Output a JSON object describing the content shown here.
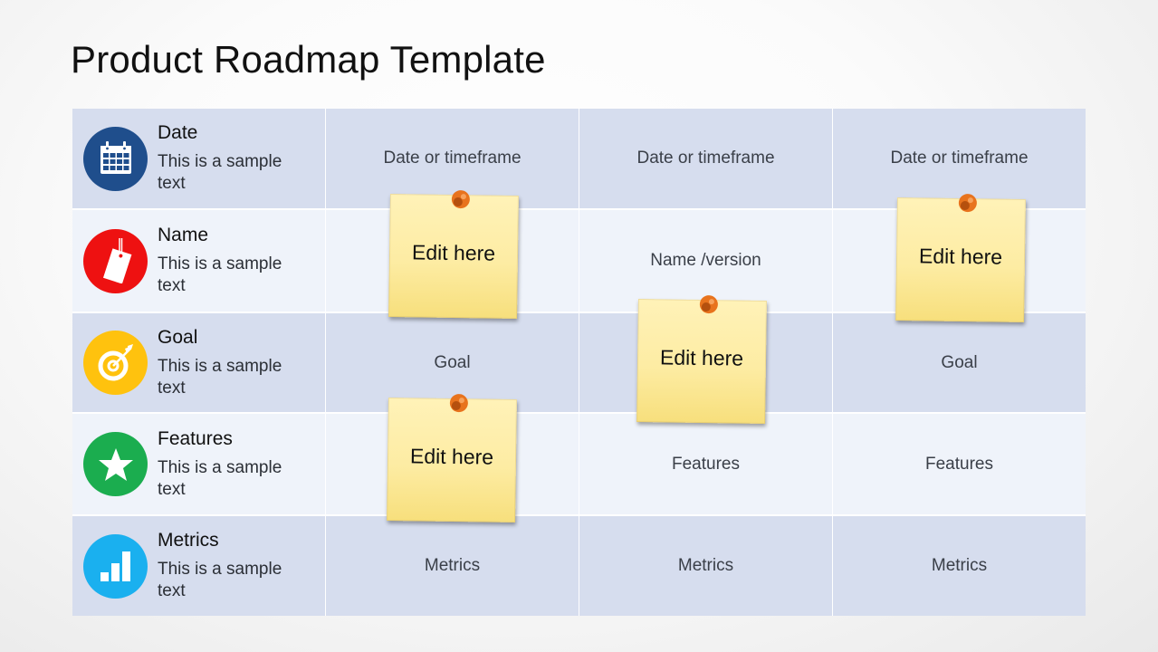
{
  "title": "Product Roadmap Template",
  "rows": [
    {
      "label": "Date",
      "description": "This is a sample text",
      "icon": "calendar-icon",
      "icon_color": "#1f4e8c",
      "cells": [
        "Date or timeframe",
        "Date or timeframe",
        "Date or timeframe"
      ]
    },
    {
      "label": "Name",
      "description": "This is a sample text",
      "icon": "tag-icon",
      "icon_color": "#ee1111",
      "cells": [
        "",
        "Name  /version",
        ""
      ]
    },
    {
      "label": "Goal",
      "description": "This is a sample text",
      "icon": "target-icon",
      "icon_color": "#ffc20e",
      "cells": [
        "Goal",
        "",
        "Goal"
      ]
    },
    {
      "label": "Features",
      "description": "This is a sample text",
      "icon": "star-icon",
      "icon_color": "#1bad4f",
      "cells": [
        "",
        "Features",
        "Features"
      ]
    },
    {
      "label": "Metrics",
      "description": "This is a sample text",
      "icon": "bar-chart-icon",
      "icon_color": "#1ab0ef",
      "cells": [
        "Metrics",
        "Metrics",
        "Metrics"
      ]
    }
  ],
  "sticky_notes": [
    {
      "text": "Edit here",
      "row": "Name",
      "column": 1
    },
    {
      "text": "Edit here",
      "row": "Name",
      "column": 3
    },
    {
      "text": "Edit here",
      "row": "Goal",
      "column": 2
    },
    {
      "text": "Edit here",
      "row": "Features",
      "column": 1
    }
  ],
  "colors": {
    "row_dark": "#d6ddee",
    "row_light": "#eff3fa",
    "note": "#fdeca3",
    "pin": "#e8731d"
  }
}
